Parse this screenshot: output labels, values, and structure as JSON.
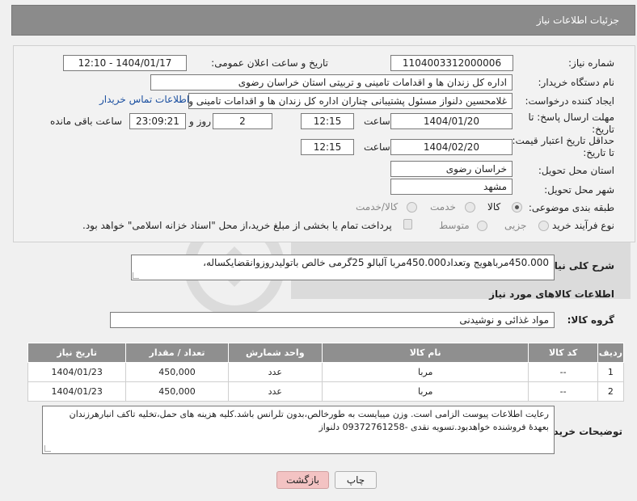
{
  "header": {
    "title": "جزئیات اطلاعات نیاز"
  },
  "fields": {
    "need_number_label": "شماره نیاز:",
    "need_number": "1104003312000006",
    "announce_label": "تاریخ و ساعت اعلان عمومی:",
    "announce_value": "1404/01/17 - 12:10",
    "buyer_org_label": "نام دستگاه خریدار:",
    "buyer_org": "اداره کل زندان ها و اقدامات تامینی و تربیتی استان خراسان رضوی",
    "requester_label": "ایجاد کننده درخواست:",
    "requester": "غلامحسین دلنواز مسئول پشتیبانی چناران اداره کل زندان ها و اقدامات تامینی و تربیتی",
    "contact_link": "اطلاعات تماس خریدار",
    "deadline_label_1": "مهلت ارسال پاسخ: تا",
    "deadline_label_2": "تاریخ:",
    "deadline_date": "1404/01/20",
    "time_label": "ساعت",
    "deadline_time": "12:15",
    "days_value": "2",
    "days_label": "روز و",
    "remaining_time": "23:09:21",
    "remaining_label": "ساعت باقی مانده",
    "price_label_1": "حداقل تاریخ اعتبار قیمت:",
    "price_label_2": "تا تاریخ:",
    "price_date": "1404/02/20",
    "price_time": "12:15",
    "province_label": "استان محل تحویل:",
    "province": "خراسان رضوی",
    "city_label": "شهر محل تحویل:",
    "city": "مشهد",
    "category_label": "طبقه بندی موضوعی:",
    "category_options": [
      "کالا",
      "خدمت",
      "کالا/خدمت"
    ],
    "category_selected": "کالا",
    "process_label": "نوع فرآیند خرید :",
    "process_options": [
      "جزیی",
      "متوسط"
    ],
    "payment_note": "پرداخت تمام یا بخشی از مبلغ خرید،از محل \"اسناد خزانه اسلامی\" خواهد بود."
  },
  "description": {
    "label": "شرح کلی نیاز:",
    "text": "450.000مرباهویج وتعداد450.000مربا آلبالو 25گرمی خالص باتولیدروزوانقضایکساله،"
  },
  "goods": {
    "section_title": "اطلاعات کالاهای مورد نیاز",
    "group_label": "گروه کالا:",
    "group_value": "مواد غذائی و نوشیدنی"
  },
  "table": {
    "headers": [
      "ردیف",
      "کد کالا",
      "نام کالا",
      "واحد شمارش",
      "تعداد / مقدار",
      "تاریخ نیاز"
    ],
    "rows": [
      [
        "1",
        "--",
        "مربا",
        "عدد",
        "450,000",
        "1404/01/23"
      ],
      [
        "2",
        "--",
        "مربا",
        "عدد",
        "450,000",
        "1404/01/23"
      ]
    ]
  },
  "buyer_notes": {
    "label": "توضیحات خریدار:",
    "text": "رعایت اطلاعات پیوست الزامی است. وزن میبایست به طورخالص،بدون تلرانس باشد.کلیه هزینه های حمل،تخلیه تاکف انبارهرزندان بعهدهٔ فروشنده خواهدبود.تسویه نقدی -09372761258 دلنواز"
  },
  "buttons": {
    "print": "چاپ",
    "back": "بازگشت"
  },
  "colors": {
    "header": "#8b8b8b",
    "link": "#1a4fa0",
    "back_button": "#f3c3c3"
  }
}
